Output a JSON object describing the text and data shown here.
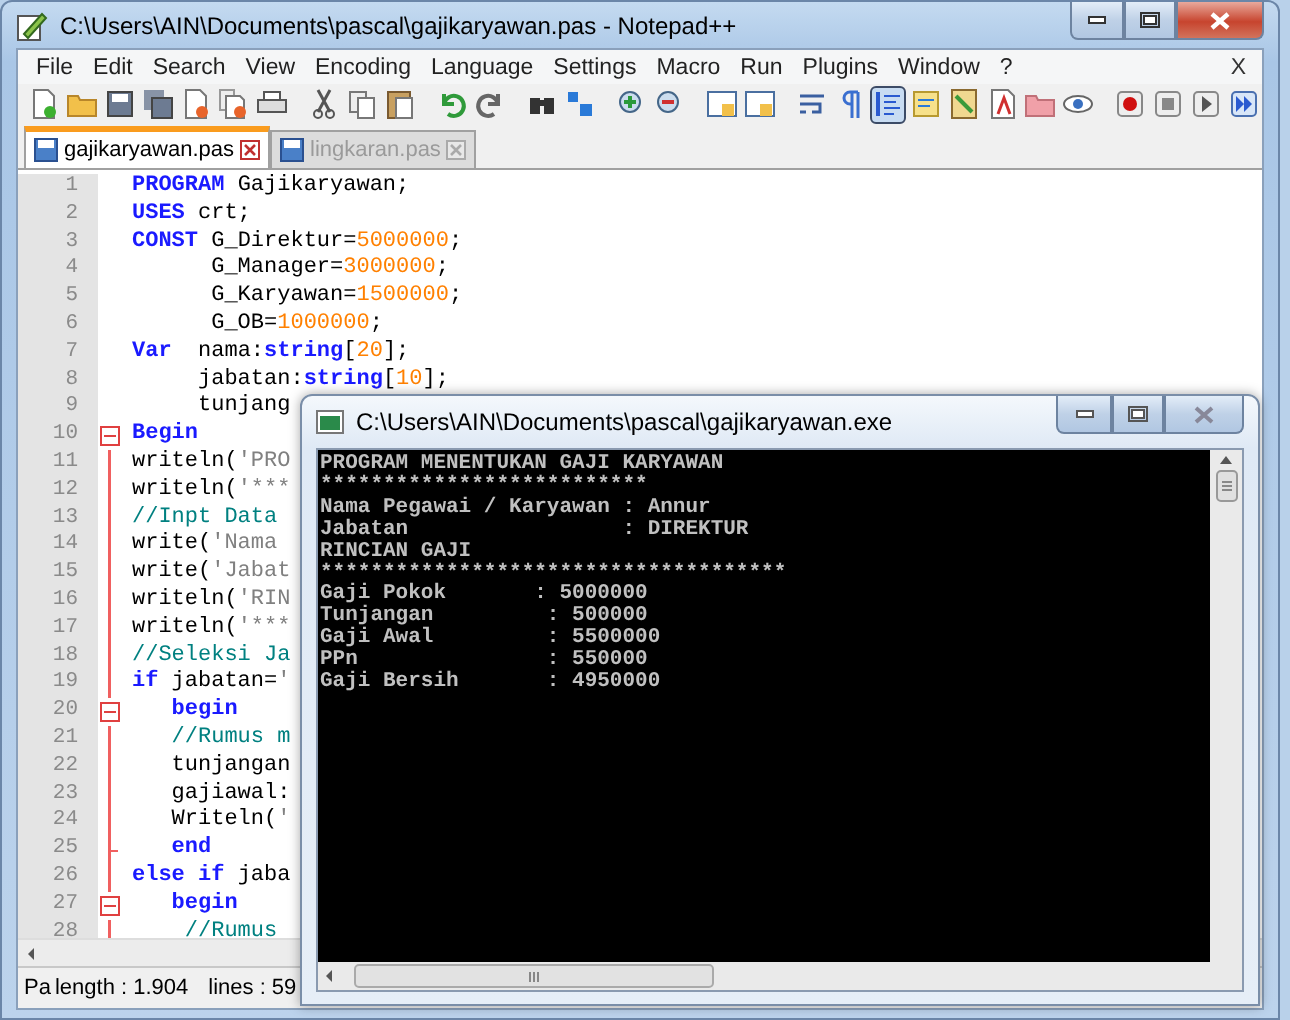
{
  "window": {
    "title": "C:\\Users\\AIN\\Documents\\pascal\\gajikaryawan.pas - Notepad++"
  },
  "menu": [
    "File",
    "Edit",
    "Search",
    "View",
    "Encoding",
    "Language",
    "Settings",
    "Macro",
    "Run",
    "Plugins",
    "Window",
    "?"
  ],
  "menu_close": "X",
  "toolbar": [
    {
      "kind": "new",
      "pressed": false
    },
    {
      "kind": "open",
      "pressed": false
    },
    {
      "kind": "save",
      "pressed": false
    },
    {
      "kind": "saveall",
      "pressed": false
    },
    {
      "kind": "close",
      "pressed": false
    },
    {
      "kind": "closeall",
      "pressed": false
    },
    {
      "kind": "print",
      "pressed": false
    },
    {
      "kind": "separator"
    },
    {
      "kind": "cut",
      "pressed": false
    },
    {
      "kind": "copy",
      "pressed": false
    },
    {
      "kind": "paste",
      "pressed": false
    },
    {
      "kind": "separator"
    },
    {
      "kind": "undo",
      "pressed": false
    },
    {
      "kind": "redo",
      "pressed": false
    },
    {
      "kind": "separator"
    },
    {
      "kind": "find",
      "pressed": false
    },
    {
      "kind": "replace",
      "pressed": false
    },
    {
      "kind": "separator"
    },
    {
      "kind": "zoomin",
      "pressed": false
    },
    {
      "kind": "zoomout",
      "pressed": false
    },
    {
      "kind": "separator"
    },
    {
      "kind": "syncv",
      "pressed": false
    },
    {
      "kind": "synch",
      "pressed": false
    },
    {
      "kind": "separator"
    },
    {
      "kind": "wrap",
      "pressed": false
    },
    {
      "kind": "allchars",
      "pressed": false
    },
    {
      "kind": "indent",
      "pressed": true
    },
    {
      "kind": "udl",
      "pressed": false
    },
    {
      "kind": "docmap",
      "pressed": false
    },
    {
      "kind": "funclist",
      "pressed": false
    },
    {
      "kind": "folder",
      "pressed": false
    },
    {
      "kind": "monitor",
      "pressed": false
    },
    {
      "kind": "separator"
    },
    {
      "kind": "record",
      "pressed": false
    },
    {
      "kind": "stop",
      "pressed": false
    },
    {
      "kind": "play",
      "pressed": false
    },
    {
      "kind": "playmulti",
      "pressed": false
    }
  ],
  "tabs": [
    {
      "label": "gajikaryawan.pas",
      "selected": true
    },
    {
      "label": "lingkaran.pas",
      "selected": false
    }
  ],
  "editor": {
    "lines": [
      {
        "number": "1",
        "fold_start": false,
        "fold_end": false,
        "tokens": [
          {
            "kind": "keyword",
            "text": "PROGRAM"
          },
          {
            "kind": "plain",
            "text": " Gajikaryawan;"
          }
        ]
      },
      {
        "number": "2",
        "fold_start": false,
        "fold_end": false,
        "tokens": [
          {
            "kind": "keyword",
            "text": "USES"
          },
          {
            "kind": "plain",
            "text": " crt;"
          }
        ]
      },
      {
        "number": "3",
        "fold_start": false,
        "fold_end": false,
        "tokens": [
          {
            "kind": "keyword",
            "text": "CONST"
          },
          {
            "kind": "plain",
            "text": " G_Direktur="
          },
          {
            "kind": "number",
            "text": "5000000"
          },
          {
            "kind": "plain",
            "text": ";"
          }
        ]
      },
      {
        "number": "4",
        "fold_start": false,
        "fold_end": false,
        "tokens": [
          {
            "kind": "plain",
            "text": "      G_Manager="
          },
          {
            "kind": "number",
            "text": "3000000"
          },
          {
            "kind": "plain",
            "text": ";"
          }
        ]
      },
      {
        "number": "5",
        "fold_start": false,
        "fold_end": false,
        "tokens": [
          {
            "kind": "plain",
            "text": "      G_Karyawan="
          },
          {
            "kind": "number",
            "text": "1500000"
          },
          {
            "kind": "plain",
            "text": ";"
          }
        ]
      },
      {
        "number": "6",
        "fold_start": false,
        "fold_end": false,
        "tokens": [
          {
            "kind": "plain",
            "text": "      G_OB="
          },
          {
            "kind": "number",
            "text": "1000000"
          },
          {
            "kind": "plain",
            "text": ";"
          }
        ]
      },
      {
        "number": "7",
        "fold_start": false,
        "fold_end": false,
        "tokens": [
          {
            "kind": "keyword",
            "text": "Var"
          },
          {
            "kind": "plain",
            "text": "  nama:"
          },
          {
            "kind": "type",
            "text": "string"
          },
          {
            "kind": "plain",
            "text": "["
          },
          {
            "kind": "number",
            "text": "20"
          },
          {
            "kind": "plain",
            "text": "];"
          }
        ]
      },
      {
        "number": "8",
        "fold_start": false,
        "fold_end": false,
        "tokens": [
          {
            "kind": "plain",
            "text": "     jabatan:"
          },
          {
            "kind": "type",
            "text": "string"
          },
          {
            "kind": "plain",
            "text": "["
          },
          {
            "kind": "number",
            "text": "10"
          },
          {
            "kind": "plain",
            "text": "];"
          }
        ]
      },
      {
        "number": "9",
        "fold_start": false,
        "fold_end": false,
        "tokens": [
          {
            "kind": "plain",
            "text": "     tunjang"
          }
        ]
      },
      {
        "number": "10",
        "fold_start": true,
        "fold_end": false,
        "tokens": [
          {
            "kind": "keyword",
            "text": "Begin"
          }
        ]
      },
      {
        "number": "11",
        "fold_start": false,
        "fold_end": false,
        "tokens": [
          {
            "kind": "plain",
            "text": "writeln("
          },
          {
            "kind": "string",
            "text": "'PRO"
          }
        ]
      },
      {
        "number": "12",
        "fold_start": false,
        "fold_end": false,
        "tokens": [
          {
            "kind": "plain",
            "text": "writeln("
          },
          {
            "kind": "string",
            "text": "'***"
          }
        ]
      },
      {
        "number": "13",
        "fold_start": false,
        "fold_end": false,
        "tokens": [
          {
            "kind": "comment",
            "text": "//Inpt Data"
          }
        ]
      },
      {
        "number": "14",
        "fold_start": false,
        "fold_end": false,
        "tokens": [
          {
            "kind": "plain",
            "text": "write("
          },
          {
            "kind": "string",
            "text": "'Nama"
          }
        ]
      },
      {
        "number": "15",
        "fold_start": false,
        "fold_end": false,
        "tokens": [
          {
            "kind": "plain",
            "text": "write("
          },
          {
            "kind": "string",
            "text": "'Jabat"
          }
        ]
      },
      {
        "number": "16",
        "fold_start": false,
        "fold_end": false,
        "tokens": [
          {
            "kind": "plain",
            "text": "writeln("
          },
          {
            "kind": "string",
            "text": "'RIN"
          }
        ]
      },
      {
        "number": "17",
        "fold_start": false,
        "fold_end": false,
        "tokens": [
          {
            "kind": "plain",
            "text": "writeln("
          },
          {
            "kind": "string",
            "text": "'***"
          }
        ]
      },
      {
        "number": "18",
        "fold_start": false,
        "fold_end": false,
        "tokens": [
          {
            "kind": "comment",
            "text": "//Seleksi Ja"
          }
        ]
      },
      {
        "number": "19",
        "fold_start": false,
        "fold_end": false,
        "tokens": [
          {
            "kind": "keyword",
            "text": "if"
          },
          {
            "kind": "plain",
            "text": " jabatan="
          },
          {
            "kind": "string",
            "text": "'"
          }
        ]
      },
      {
        "number": "20",
        "fold_start": true,
        "fold_end": false,
        "tokens": [
          {
            "kind": "keyword",
            "text": "   begin"
          }
        ]
      },
      {
        "number": "21",
        "fold_start": false,
        "fold_end": false,
        "tokens": [
          {
            "kind": "comment",
            "text": "   //Rumus m"
          }
        ]
      },
      {
        "number": "22",
        "fold_start": false,
        "fold_end": false,
        "tokens": [
          {
            "kind": "plain",
            "text": "   tunjangan"
          }
        ]
      },
      {
        "number": "23",
        "fold_start": false,
        "fold_end": false,
        "tokens": [
          {
            "kind": "plain",
            "text": "   gajiawal:"
          }
        ]
      },
      {
        "number": "24",
        "fold_start": false,
        "fold_end": false,
        "tokens": [
          {
            "kind": "plain",
            "text": "   Writeln("
          },
          {
            "kind": "string",
            "text": "'"
          }
        ]
      },
      {
        "number": "25",
        "fold_start": false,
        "fold_end": true,
        "tokens": [
          {
            "kind": "keyword",
            "text": "   end"
          }
        ]
      },
      {
        "number": "26",
        "fold_start": false,
        "fold_end": false,
        "tokens": [
          {
            "kind": "keyword",
            "text": "else if"
          },
          {
            "kind": "plain",
            "text": " jaba"
          }
        ]
      },
      {
        "number": "27",
        "fold_start": true,
        "fold_end": false,
        "tokens": [
          {
            "kind": "keyword",
            "text": "   begin"
          }
        ]
      },
      {
        "number": "28",
        "fold_start": false,
        "fold_end": false,
        "tokens": [
          {
            "kind": "comment",
            "text": "    //Rumus"
          }
        ]
      }
    ]
  },
  "status_bar": {
    "language": "Pa",
    "length": "length : 1.904",
    "lines": "lines : 59"
  },
  "console": {
    "title": "C:\\Users\\AIN\\Documents\\pascal\\gajikaryawan.exe",
    "lines": [
      "PROGRAM MENENTUKAN GAJI KARYAWAN",
      "**************************",
      "Nama Pegawai / Karyawan : Annur",
      "Jabatan                 : DIREKTUR",
      "RINCIAN GAJI",
      "*************************************",
      "Gaji Pokok       : 5000000",
      "Tunjangan         : 500000",
      "Gaji Awal         : 5500000",
      "PPn               : 550000",
      "Gaji Bersih       : 4950000"
    ]
  }
}
